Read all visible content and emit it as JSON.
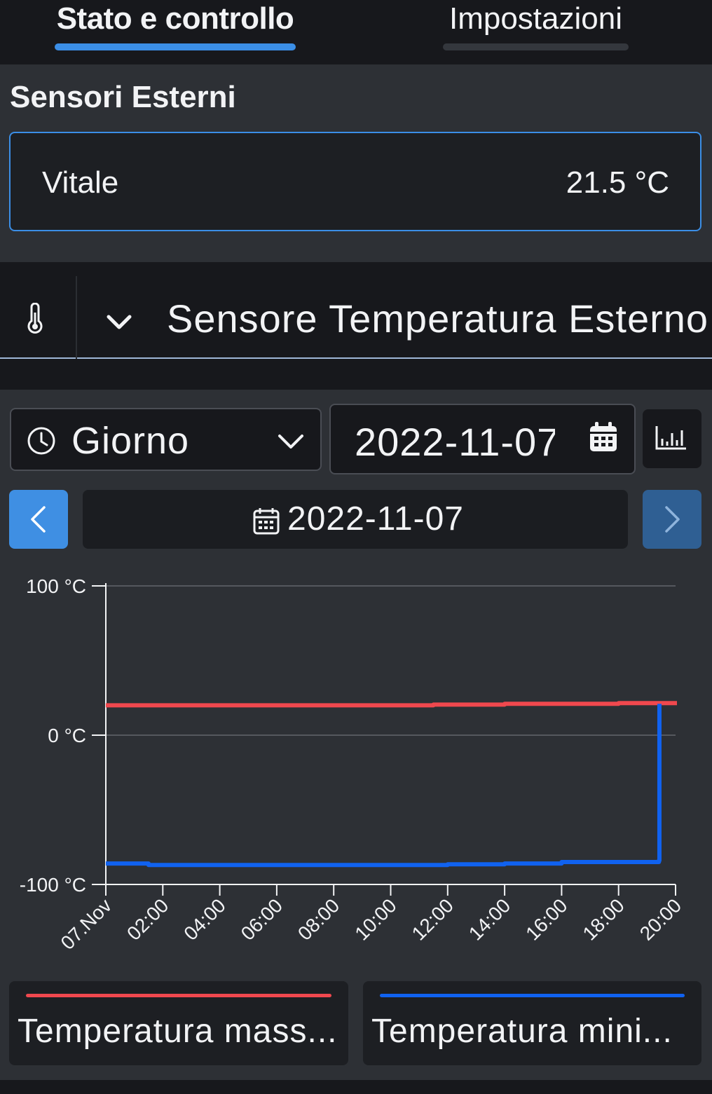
{
  "tabs": [
    {
      "label": "Stato e controllo",
      "active": true
    },
    {
      "label": "Impostazioni",
      "active": false
    }
  ],
  "section": {
    "title": "Sensori Esterni"
  },
  "sensor_card": {
    "name": "Vitale",
    "value": "21.5 °C"
  },
  "sensor_selector": {
    "icon": "thermometer-icon",
    "expand_icon": "chevron-down-icon",
    "title": "Sensore Temperatura Esterno"
  },
  "controls": {
    "period": {
      "label": "Giorno",
      "icon": "clock-icon"
    },
    "date_input": {
      "value": "2022-11-07",
      "icon": "calendar-icon"
    },
    "chart_toggle": {
      "icon": "bar-chart-icon"
    },
    "date_display": "2022-11-07",
    "prev_icon": "chevron-left-icon",
    "next_icon": "chevron-right-icon"
  },
  "colors": {
    "accent": "#3b8ee6",
    "max_series": "#f0484e",
    "min_series": "#1062f0"
  },
  "chart_data": {
    "type": "line",
    "x_ticks": [
      "07.Nov",
      "02:00",
      "04:00",
      "06:00",
      "08:00",
      "10:00",
      "12:00",
      "14:00",
      "16:00",
      "18:00",
      "20:00"
    ],
    "y_ticks": [
      "100 °C",
      "0 °C",
      "-100 °C"
    ],
    "ylim": [
      -100,
      100
    ],
    "grid": true,
    "legend_position": "bottom",
    "series": [
      {
        "name": "Temperatura mass...",
        "color": "#f0484e",
        "x": [
          "00:00",
          "04:00",
          "08:00",
          "11:30",
          "14:00",
          "18:00",
          "19:40"
        ],
        "values": [
          20,
          20,
          20,
          20.5,
          21,
          21.5,
          21.5
        ]
      },
      {
        "name": "Temperatura mini...",
        "color": "#1062f0",
        "x": [
          "00:00",
          "01:30",
          "04:00",
          "08:00",
          "10:00",
          "12:00",
          "14:00",
          "16:00",
          "18:00",
          "19:25",
          "19:26"
        ],
        "values": [
          -86,
          -87,
          -87,
          -87,
          -87,
          -86.5,
          -86,
          -85,
          -85,
          -84,
          21
        ]
      }
    ]
  }
}
